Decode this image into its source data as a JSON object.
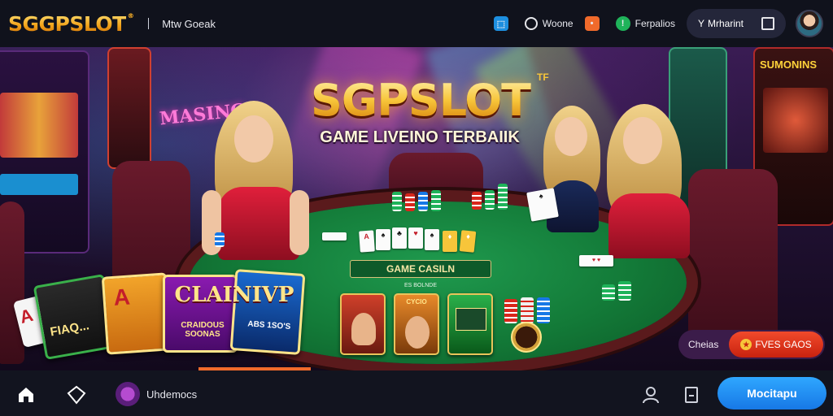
{
  "header": {
    "logo": "SGGPSLOT",
    "logo_tm": "®",
    "nav_text": "Mtw Goeak",
    "items": [
      {
        "icon": "shield-icon",
        "label": ""
      },
      {
        "icon": "chat-icon",
        "label": "Woone"
      },
      {
        "icon": "chat-bubble-icon",
        "label": ""
      },
      {
        "icon": "leaf-icon",
        "label": "Ferpalios"
      }
    ],
    "user_prefix": "Y",
    "user_name": "Mrharint"
  },
  "hero": {
    "title": "SGPSLOT",
    "title_tm": "TF",
    "subtitle": "GAME LIVEINO TERBAIIK",
    "bg_sign": "MASING",
    "right_sign": "SUMONINS",
    "table_label": "GAME CASILN",
    "table_small_text": "ES BOLNDE",
    "vip_title": "CLAINIVP",
    "vip_sub_left": "CRAIDOUS SOONAS",
    "vip_sub_right": "ABS 1SO'S",
    "card_left_text": "FIAQ...",
    "tiles": [
      {
        "label": ""
      },
      {
        "label": "CYCIO"
      },
      {
        "label": ""
      },
      {
        "label": ""
      }
    ],
    "float_left": "Cheias",
    "float_right": "FVES GAOS"
  },
  "bottom": {
    "label": "Uhdemocs",
    "cta": "Mocitapu"
  },
  "colors": {
    "accent_gold": "#f7c53a",
    "cta_blue": "#1f8ff0",
    "promo_red": "#d8261b",
    "table_green": "#137a38"
  }
}
